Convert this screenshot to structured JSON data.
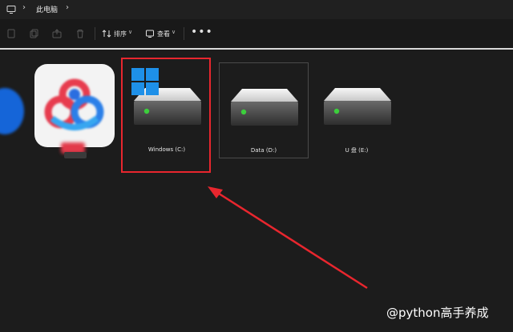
{
  "address_bar": {
    "icon": "monitor-icon",
    "breadcrumb": "此电脑"
  },
  "toolbar": {
    "sort_label": "排序",
    "view_label": "查看",
    "more_label": "•••"
  },
  "drives": [
    {
      "label": "Windows (C:)",
      "status_color": "#3ccf3c"
    },
    {
      "label": "Data (D:)",
      "status_color": "#3ccf3c"
    },
    {
      "label": "U 盘 (E:)",
      "status_color": "#3ccf3c"
    }
  ],
  "highlight_color": "#e8262e",
  "watermark": "@python高手养成"
}
